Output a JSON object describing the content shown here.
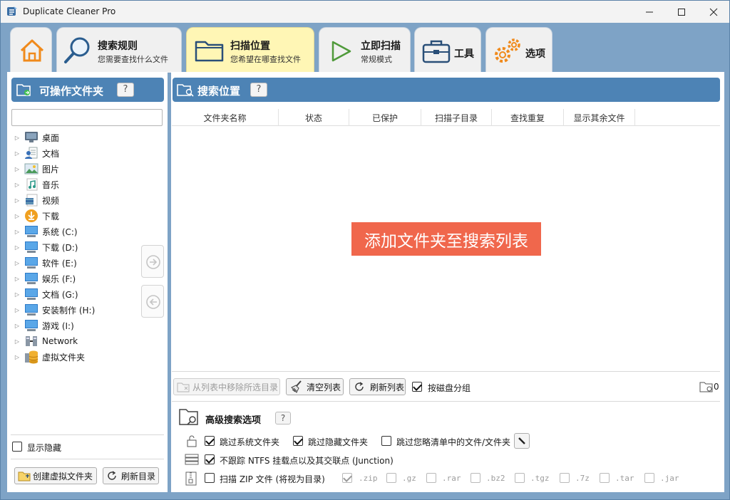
{
  "window": {
    "title": "Duplicate Cleaner Pro"
  },
  "tabs": [
    {
      "title": "搜索规则",
      "subtitle": "您需要查找什么文件"
    },
    {
      "title": "扫描位置",
      "subtitle": "您希望在哪查找文件"
    },
    {
      "title": "立即扫描",
      "subtitle": "常规模式"
    },
    {
      "title": "工具"
    },
    {
      "title": "选项"
    }
  ],
  "left_panel": {
    "header": "可操作文件夹",
    "help": "?",
    "filter_placeholder": "",
    "tree": [
      {
        "label": "桌面",
        "icon": "desktop-icon"
      },
      {
        "label": "文档",
        "icon": "documents-icon"
      },
      {
        "label": "图片",
        "icon": "pictures-icon"
      },
      {
        "label": "音乐",
        "icon": "music-icon"
      },
      {
        "label": "视频",
        "icon": "videos-icon"
      },
      {
        "label": "下载",
        "icon": "downloads-icon"
      },
      {
        "label": "系统 (C:)",
        "icon": "drive-icon"
      },
      {
        "label": "下载 (D:)",
        "icon": "drive-icon"
      },
      {
        "label": "软件 (E:)",
        "icon": "drive-icon"
      },
      {
        "label": "娱乐 (F:)",
        "icon": "drive-icon"
      },
      {
        "label": "文档 (G:)",
        "icon": "drive-icon"
      },
      {
        "label": "安装制作 (H:)",
        "icon": "drive-icon"
      },
      {
        "label": "游戏 (I:)",
        "icon": "drive-icon"
      },
      {
        "label": "Network",
        "icon": "network-icon"
      },
      {
        "label": "虚拟文件夹",
        "icon": "virtual-folder-icon"
      }
    ],
    "show_hidden": "显示隐藏",
    "create_virtual": "创建虚拟文件夹",
    "refresh_dir": "刷新目录"
  },
  "right_panel": {
    "header": "搜索位置",
    "help": "?",
    "columns": [
      "文件夹名称",
      "状态",
      "已保护",
      "扫描子目录",
      "查找重复",
      "显示其余文件"
    ],
    "empty_hint": "添加文件夹至搜索列表",
    "remove_selected": "从列表中移除所选目录",
    "clear_list": "清空列表",
    "refresh_list": "刷新列表",
    "group_by_disk": "按磁盘分组",
    "folder_count": "0"
  },
  "advanced": {
    "title": "高级搜索选项",
    "help": "?",
    "skip_system": "跳过系统文件夹",
    "skip_hidden": "跳过隐藏文件夹",
    "skip_ignore": "跳过您略清单中的文件/文件夹",
    "no_ntfs": "不跟踪 NTFS 挂载点以及其交联点 (Junction)",
    "scan_zip": "扫描 ZIP 文件 (将视为目录)",
    "archive_types": [
      ".zip",
      ".gz",
      ".rar",
      ".bz2",
      ".tgz",
      ".7z",
      ".tar",
      ".jar"
    ]
  },
  "colors": {
    "accent": "#4d83b5",
    "active_tab": "#fff6b5",
    "hint": "#f0674c"
  }
}
